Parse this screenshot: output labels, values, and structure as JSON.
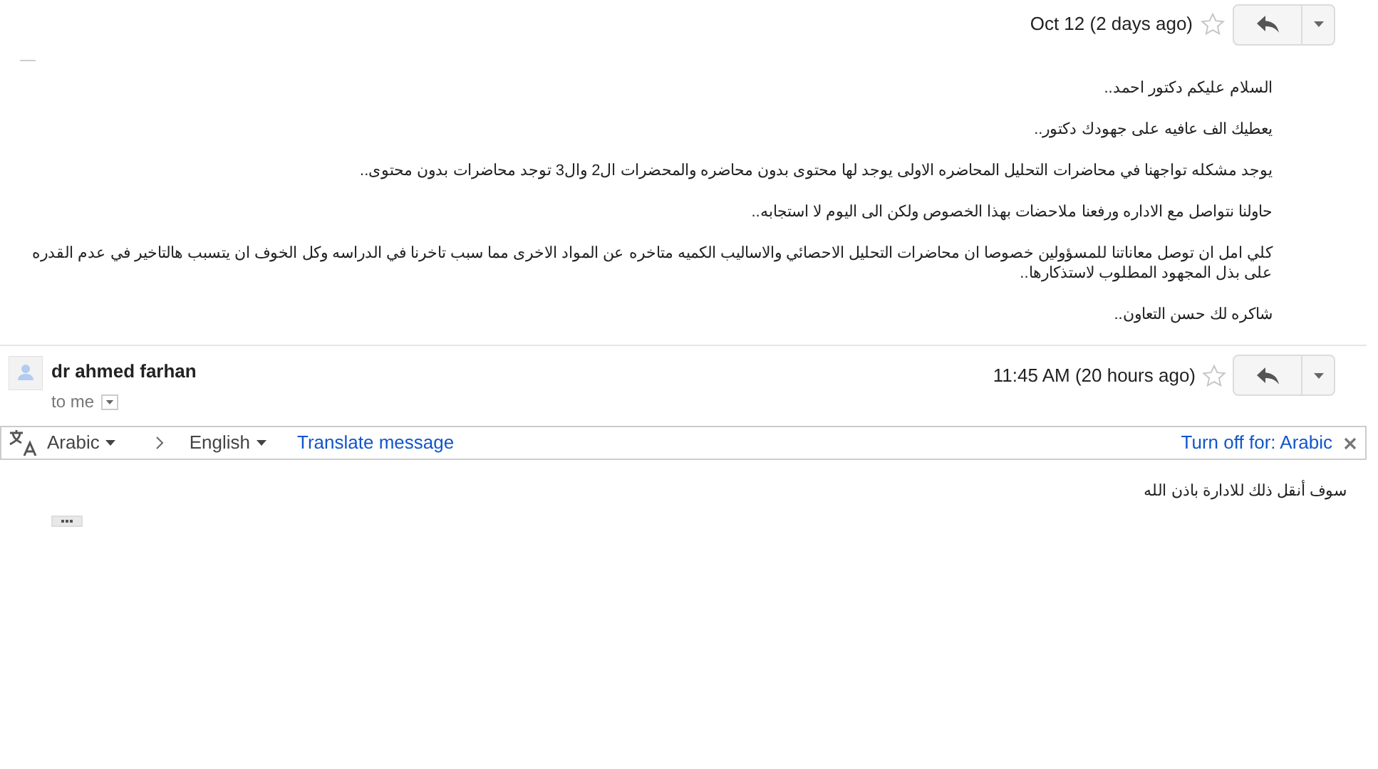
{
  "messages": [
    {
      "kind": "expanded-top",
      "date": "Oct 12 (2 days ago)",
      "starred": false,
      "paragraphs": [
        "السلام عليكم دكتور احمد..",
        "يعطيك الف عافيه على جهودك دكتور..",
        "يوجد مشكله تواجهنا في محاضرات التحليل المحاضره الاولى يوجد لها محتوى بدون محاضره والمحضرات ال2 وال3 توجد محاضرات بدون محتوى..",
        "حاولنا نتواصل مع الاداره ورفعنا ملاحضات بهذا الخصوص ولكن الى اليوم لا استجابه..",
        "كلي امل ان توصل معاناتنا للمسؤولين خصوصا ان محاضرات التحليل الاحصائي والاساليب الكميه متاخره عن المواد الاخرى مما سبب تاخرنا في الدراسه وكل الخوف ان يتسبب هالتاخير في عدم القدره على بذل المجهود المطلوب لاستذكارها..",
        "شاكره لك حسن التعاون.."
      ]
    },
    {
      "kind": "full",
      "sender": "dr ahmed farhan",
      "recipient": "to me",
      "date": "11:45 AM (20 hours ago)",
      "starred": false,
      "translate": {
        "from": "Arabic",
        "to": "English",
        "action": "Translate message",
        "turn_off": "Turn off for: Arabic"
      },
      "paragraphs": [
        "سوف أنقل ذلك للادارة باذن الله"
      ]
    }
  ]
}
